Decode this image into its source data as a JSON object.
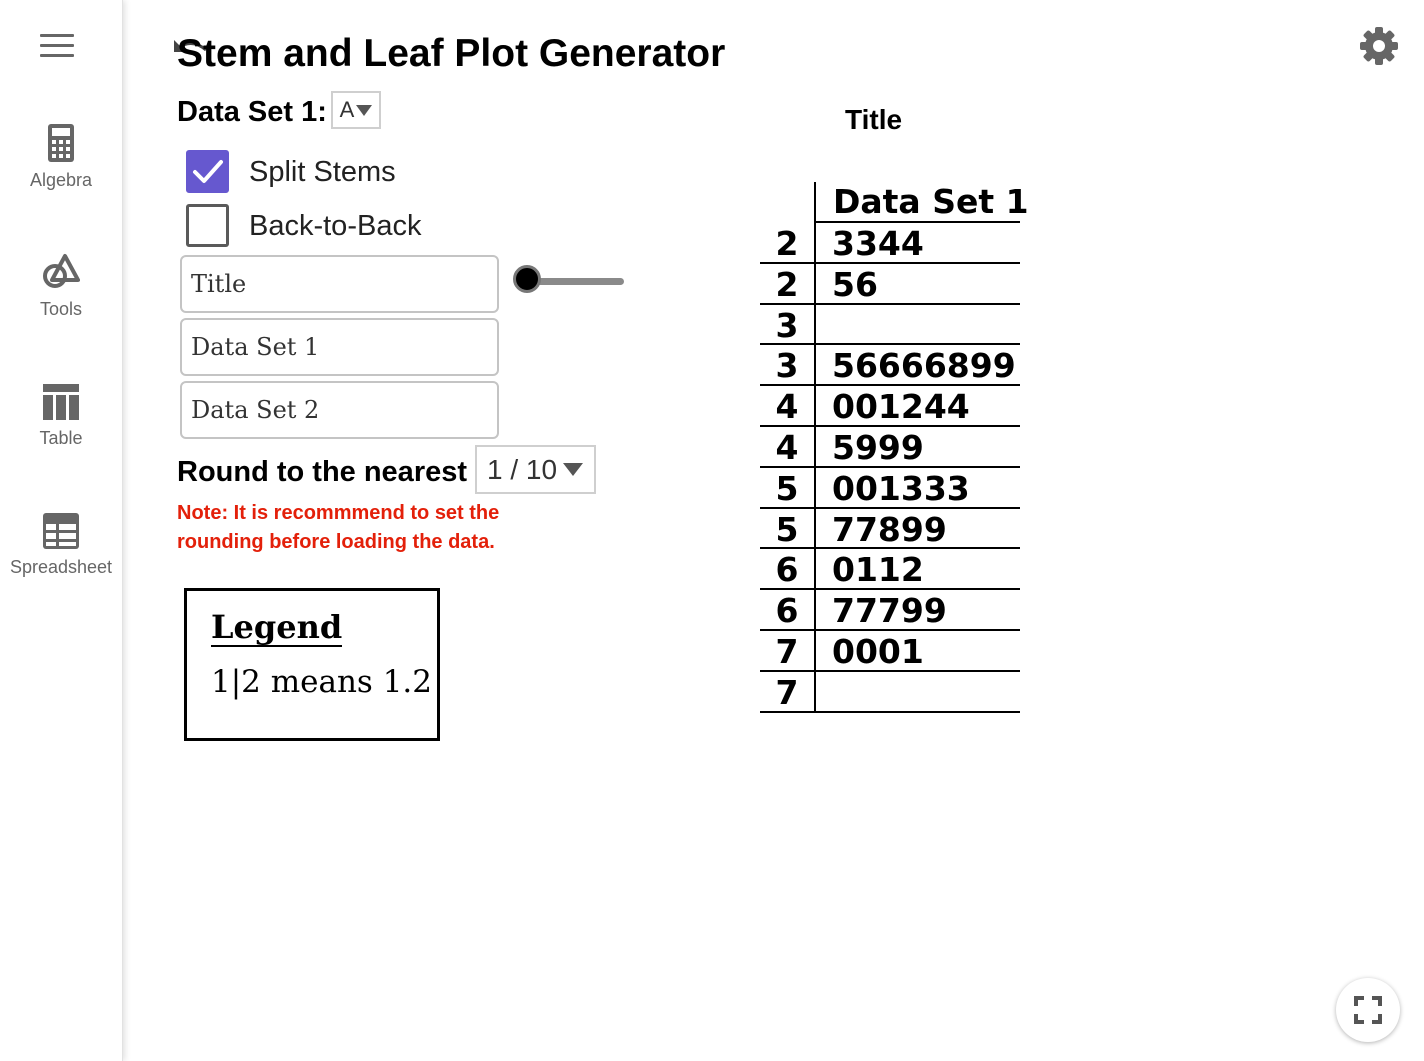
{
  "sidebar": {
    "items": [
      {
        "label": "Algebra",
        "icon": "calculator-icon"
      },
      {
        "label": "Tools",
        "icon": "tools-icon"
      },
      {
        "label": "Table",
        "icon": "table-icon"
      },
      {
        "label": "Spreadsheet",
        "icon": "spreadsheet-icon"
      }
    ]
  },
  "header": {
    "title": "Stem and Leaf Plot Generator"
  },
  "controls": {
    "dataset_label": "Data Set 1:",
    "dataset_selected": "A",
    "split_stems": {
      "label": "Split Stems",
      "checked": true
    },
    "back_to_back": {
      "label": "Back-to-Back",
      "checked": false
    },
    "title_field": "Title",
    "dataset1_field": "Data Set 1",
    "dataset2_field": "Data Set 2",
    "slider_value": 0,
    "round_label": "Round to the nearest",
    "round_selected": "1 / 10",
    "note": "Note: It is recommmend to set the rounding before loading the data."
  },
  "legend": {
    "title": "Legend",
    "text": "1|2 means 1.2"
  },
  "plot": {
    "title": "Title",
    "header": "Data Set 1",
    "rows": [
      {
        "stem": "2",
        "leaf": "3344"
      },
      {
        "stem": "2",
        "leaf": "56"
      },
      {
        "stem": "3",
        "leaf": ""
      },
      {
        "stem": "3",
        "leaf": "56666899"
      },
      {
        "stem": "4",
        "leaf": "001244"
      },
      {
        "stem": "4",
        "leaf": "5999"
      },
      {
        "stem": "5",
        "leaf": "001333"
      },
      {
        "stem": "5",
        "leaf": "77899"
      },
      {
        "stem": "6",
        "leaf": "0112"
      },
      {
        "stem": "6",
        "leaf": "77799"
      },
      {
        "stem": "7",
        "leaf": "0001"
      },
      {
        "stem": "7",
        "leaf": ""
      }
    ]
  },
  "colors": {
    "accent": "#6658cf",
    "note": "#e3200a",
    "sidebar_text": "#666666"
  }
}
